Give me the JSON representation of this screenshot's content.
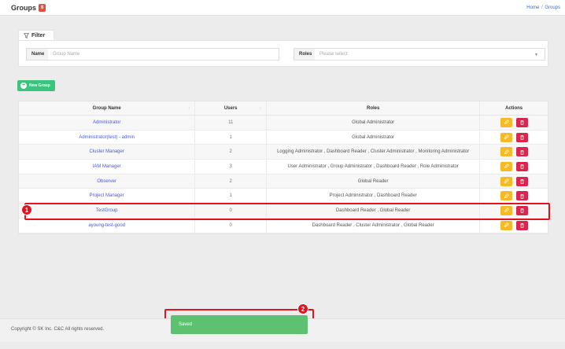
{
  "header": {
    "title": "Groups",
    "count_badge": "8",
    "breadcrumb": [
      "Home",
      "Groups"
    ]
  },
  "filter": {
    "tab_label": "Filter",
    "name_label": "Name",
    "name_placeholder": "Group Name",
    "roles_label": "Roles",
    "roles_placeholder": "Please select"
  },
  "new_group_label": "New Group",
  "table": {
    "columns": [
      "Group Name",
      "Users",
      "Roles",
      "Actions"
    ],
    "rows": [
      {
        "name": "Administrator",
        "users": "11",
        "roles": "Global Administrator"
      },
      {
        "name": "Administrator(test) - admin",
        "users": "1",
        "roles": "Global Administrator"
      },
      {
        "name": "Cluster Manager",
        "users": "2",
        "roles": "Logging Administrator , Dashboard Reader , Cluster Administrator , Monitoring Administrator"
      },
      {
        "name": "IAM Manager",
        "users": "3",
        "roles": "User Administrator , Group Administrator , Dashboard Reader , Role Administrator"
      },
      {
        "name": "Observer",
        "users": "2",
        "roles": "Global Reader"
      },
      {
        "name": "Project Manager",
        "users": "1",
        "roles": "Project Administrator , Dashboard Reader"
      },
      {
        "name": "TestGroup",
        "users": "0",
        "roles": "Dashboard Reader , Global Reader"
      },
      {
        "name": "ayoung-test-good",
        "users": "0",
        "roles": "Dashboard Reader , Cluster Administrator , Global Reader"
      }
    ]
  },
  "annotations": {
    "step1": "1",
    "step2": "2"
  },
  "footer": {
    "copyright": "Copyright © SK Inc. C&C All rights reserved."
  },
  "toast": {
    "message": "Saved"
  },
  "colors": {
    "accent": "#3f6ad8",
    "success": "#3ac47d",
    "warning": "#f7b924",
    "danger": "#d92550",
    "highlight": "#e0141e"
  },
  "icons": {
    "filter": "filter-icon",
    "add": "plus-icon",
    "edit": "pencil-icon",
    "delete": "trash-icon",
    "dropdown": "chevron-down-icon"
  }
}
